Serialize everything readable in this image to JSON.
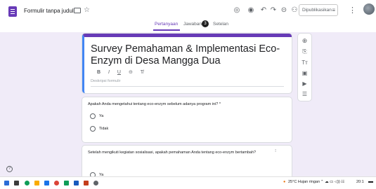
{
  "app": {
    "doc_title": "Formulir tanpa judul",
    "icons": [
      "folder-icon",
      "star-icon"
    ]
  },
  "toolbar": {
    "icons": [
      "palette-icon",
      "preview-icon",
      "undo-icon",
      "redo-icon",
      "link-icon",
      "add-collaborator-icon"
    ],
    "publish_label": "Dipublikasikan"
  },
  "tabs": [
    {
      "label": "Pertanyaan",
      "active": true
    },
    {
      "label": "Jawaban",
      "active": false
    },
    {
      "label": "Setelan",
      "active": false
    }
  ],
  "responses_badge": "3",
  "form": {
    "title": "Survey Pemahaman & Implementasi Eco-Enzym di Desa Mangga Dua",
    "format_buttons": [
      "B",
      "I",
      "U",
      "⊝",
      "T̸"
    ],
    "description_placeholder": "Deskripsi formulir"
  },
  "questions": [
    {
      "text": "Apakah Anda mengetahui tentang eco-enzym sebelum adanya program ini? *",
      "options": [
        "Ya",
        "Tidak"
      ]
    },
    {
      "text": "Setelah mengikuti kegiatan sosialisasi, apakah pemahaman Anda tentang eco-enzym bertambah?",
      "options": [
        "Ya"
      ]
    }
  ],
  "side_tools": [
    "add-question-icon",
    "import-icon",
    "add-title-icon",
    "add-image-icon",
    "add-video-icon",
    "add-section-icon"
  ],
  "taskbar": {
    "weather": "25°C Hujan ringan",
    "tray_glyphs": "⌃ ☁ ▭ ◁)) ☷",
    "time": "20:1"
  },
  "colors": {
    "accent": "#673ab7",
    "background": "#f0ebf8",
    "active_card": "#4285f4"
  }
}
